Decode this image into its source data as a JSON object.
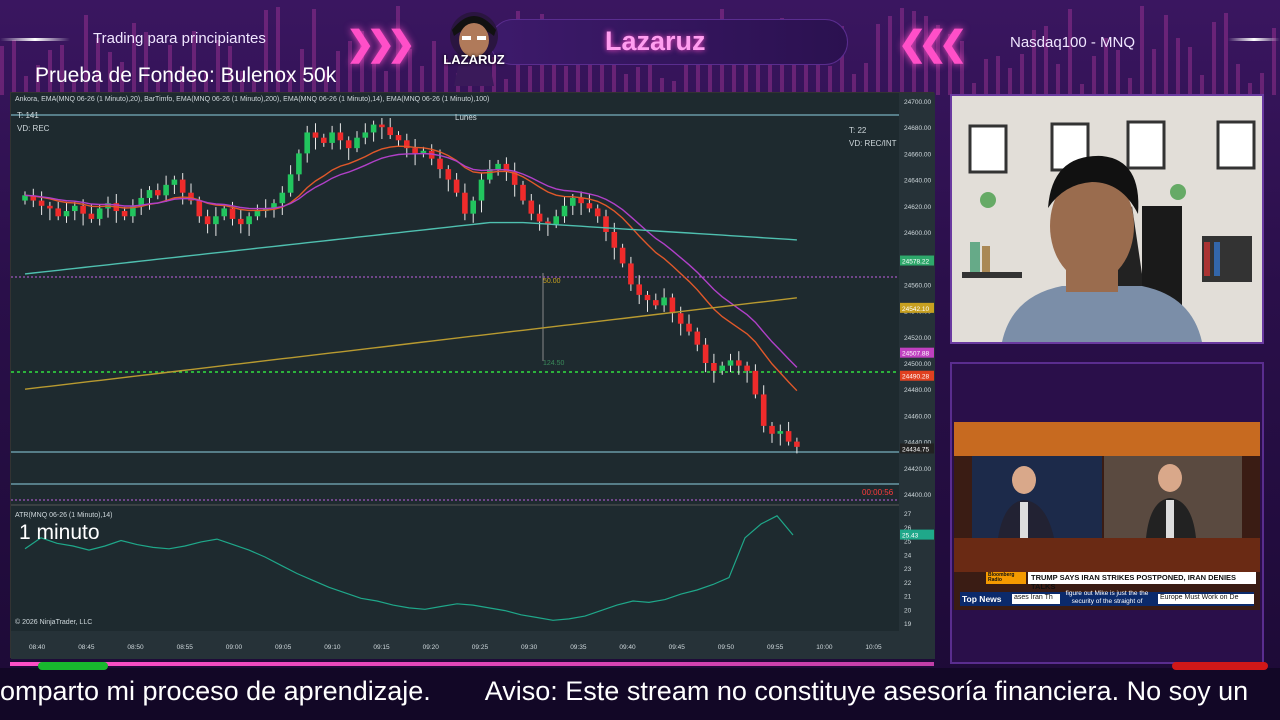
{
  "overlay": {
    "top_left_text": "Trading para principiantes",
    "top_right_text": "Nasdaq100 - MNQ",
    "streamer_name": "Lazaruz",
    "avatar_label": "LAZARUZ",
    "fondeo_text": "Prueba de Fondeo: Bulenox 50k",
    "timeframe_label": "1 minuto",
    "accent_color": "#ff4fc8"
  },
  "chart": {
    "header": "Ankora, EMA(MNQ 06-26 (1 Minuto),20), BarTimfo, EMA(MNQ 06-26 (1 Minuto),200), EMA(MNQ 06-26 (1 Minuto),14), EMA(MNQ 06-26 (1 Minuto),100)",
    "t_left": "T: 141",
    "vd_left": "VD: REC",
    "day_label": "Lunes",
    "t_right": "T: 22",
    "vd_right": "VD: REC/INT",
    "atr_label": "ATR(MNQ 06-26 (1 Minuto),14)",
    "copyright": "© 2026 NinjaTrader, LLC",
    "timer": "00:00:56",
    "range_label_a": "50.00",
    "range_label_b": "124.50"
  },
  "chart_data": {
    "type": "candlestick",
    "price_axis": [
      "24700.00",
      "24680.00",
      "24660.00",
      "24640.00",
      "24620.00",
      "24600.00",
      "24580.00",
      "24560.00",
      "24540.00",
      "24520.00",
      "24500.00",
      "24480.00",
      "24460.00",
      "24440.00",
      "24420.00",
      "24400.00"
    ],
    "price_tags": [
      {
        "value": "24578.22",
        "color": "#2ea86b"
      },
      {
        "value": "24542.10",
        "color": "#c8a020"
      },
      {
        "value": "24507.88",
        "color": "#c040c0"
      },
      {
        "value": "24490.28",
        "color": "#e04020"
      },
      {
        "value": "24434.75",
        "color": "#222222"
      }
    ],
    "atr_axis": [
      "27",
      "26",
      "25",
      "24",
      "23",
      "22",
      "21",
      "20",
      "19"
    ],
    "atr_tag": "25.43",
    "time_axis": [
      "08:40",
      "08:45",
      "08:50",
      "08:55",
      "09:00",
      "09:05",
      "09:10",
      "09:15",
      "09:20",
      "09:25",
      "09:30",
      "09:35",
      "09:40",
      "09:45",
      "09:50",
      "09:55",
      "10:00",
      "10:05"
    ]
  },
  "news": {
    "headline": "TRUMP SAYS IRAN STRIKES POSTPONED, IRAN DENIES TALKS",
    "tag": "Bloomberg Radio",
    "top_news": "Top News",
    "ticker_left": "ases Iran Th",
    "subtitle": "figure out Mike is just the the security of the straight of",
    "ticker_right": "Europe Must Work on De"
  },
  "ticker": {
    "part1": "omparto mi proceso de aprendizaje.",
    "part2": "Aviso: Este stream no constituye asesoría financiera. No soy un"
  }
}
